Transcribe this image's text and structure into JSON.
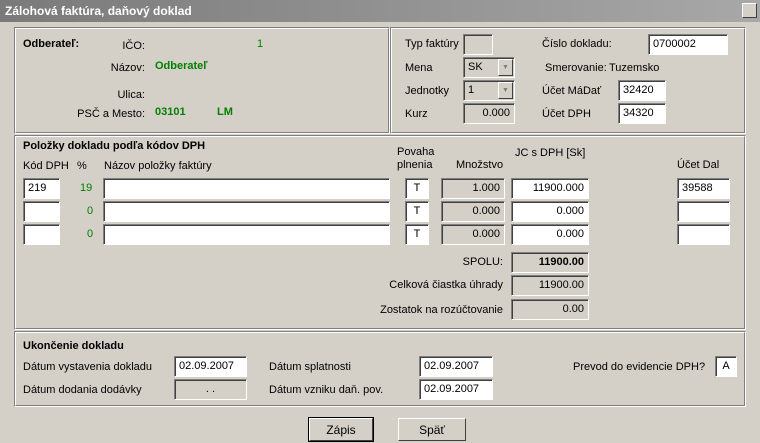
{
  "window": {
    "title": "Zálohová faktúra, daňový doklad"
  },
  "header": {
    "odberatel_label": "Odberateľ:",
    "ico_label": "IČO:",
    "ico_value": "1",
    "nazov_label": "Názov:",
    "nazov_value": "Odberateľ",
    "ulica_label": "Ulica:",
    "ulica_value": "",
    "psc_label": "PSČ a Mesto:",
    "psc_value": "03101",
    "mesto_value": "LM",
    "typ_faktury_label": "Typ faktúry",
    "typ_faktury_value": "",
    "mena_label": "Mena",
    "mena_value": "SK",
    "jednotky_label": "Jednotky",
    "jednotky_value": "1",
    "kurz_label": "Kurz",
    "kurz_value": "0.000",
    "cislo_dokladu_label": "Číslo dokladu:",
    "cislo_dokladu_value": "0700002",
    "smerovanie_label": "Smerovanie:",
    "smerovanie_value": "Tuzemsko",
    "ucet_madat_label": "Účet MáDať",
    "ucet_madat_value": "32420",
    "ucet_dph_label": "Účet DPH",
    "ucet_dph_value": "34320"
  },
  "items": {
    "section_title": "Položky dokladu podľa kódov DPH",
    "col_kod": "Kód DPH",
    "col_pct": "%",
    "col_nazov": "Názov položky faktúry",
    "col_povaha_1": "Povaha",
    "col_povaha_2": "plnenia",
    "col_mnozstvo": "Množstvo",
    "col_jc": "JC s DPH [Sk]",
    "col_ucet_dal": "Účet Dal",
    "rows": [
      {
        "kod": "219",
        "pct": "19",
        "nazov": "",
        "povaha": "T",
        "mnozstvo": "1.000",
        "jc": "11900.000",
        "ucet_dal": "39588"
      },
      {
        "kod": "",
        "pct": "0",
        "nazov": "",
        "povaha": "T",
        "mnozstvo": "0.000",
        "jc": "0.000",
        "ucet_dal": ""
      },
      {
        "kod": "",
        "pct": "0",
        "nazov": "",
        "povaha": "T",
        "mnozstvo": "0.000",
        "jc": "0.000",
        "ucet_dal": ""
      }
    ],
    "spolu_label": "SPOLU:",
    "spolu_value": "11900.00",
    "celkova_label": "Celková čiastka úhrady",
    "celkova_value": "11900.00",
    "zostatok_label": "Zostatok na rozúčtovanie",
    "zostatok_value": "0.00"
  },
  "closing": {
    "section_title": "Ukončenie dokladu",
    "vystavenia_label": "Dátum vystavenia dokladu",
    "vystavenia_value": "02.09.2007",
    "dodania_label": "Dátum dodania dodávky",
    "dodania_value": ". .",
    "splatnosti_label": "Dátum splatnosti",
    "splatnosti_value": "02.09.2007",
    "vzniku_label": "Dátum vzniku daň. pov.",
    "vzniku_value": "02.09.2007",
    "prevod_label": "Prevod do evidencie DPH?",
    "prevod_value": "A"
  },
  "buttons": {
    "zapis_label": "Zápis",
    "spat_label": "Späť"
  },
  "colors": {
    "face": "#d4d0c8",
    "value_green": "#008000",
    "title_bar": "#8c8c8c"
  }
}
